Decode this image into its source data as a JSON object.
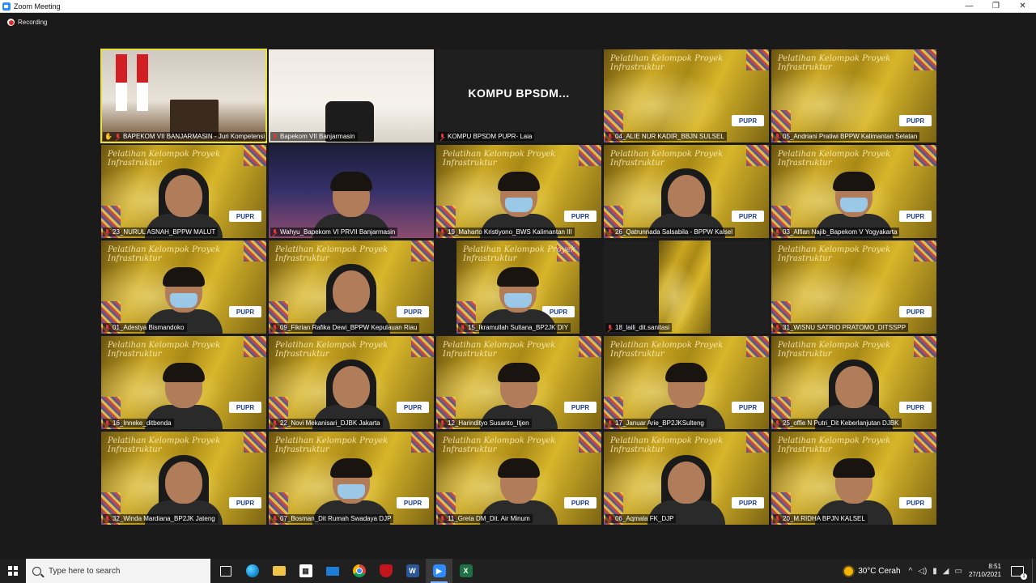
{
  "window": {
    "title": "Zoom Meeting",
    "controls": {
      "minimize": "—",
      "restore": "❐",
      "close": "✕"
    }
  },
  "recording": {
    "label": "Recording"
  },
  "tiles": [
    {
      "name": "BAPEKOM VII BANJARMASIN - Juri Kompetensi",
      "hand": "✋",
      "bg": "bg-stage",
      "active": true
    },
    {
      "name": "Bapekom VII Banjarmasin",
      "bg": "bg-office"
    },
    {
      "name": "KOMPU BPSDM PUPR- Laia",
      "bg": "bg-black",
      "big": "KOMPU  BPSDM..."
    },
    {
      "name": "04_ALIE NUR KADIR_BBJN SULSEL",
      "bg": "bg-gold",
      "slide": true
    },
    {
      "name": "05_Andriani Pratiwi BPPW Kalimantan Selatan",
      "bg": "bg-gold",
      "slide": true
    },
    {
      "name": "23_NURUL ASNAH_BPPW MALUT",
      "bg": "bg-gold",
      "slide": true,
      "person": "hijab"
    },
    {
      "name": "Wahyu_Bapekom VI PRVII Banjarmasin",
      "bg": "bg-city",
      "person": "man"
    },
    {
      "name": "19_Maharto Kristiyono_BWS Kalimantan III",
      "bg": "bg-gold",
      "slide": true,
      "person": "mask"
    },
    {
      "name": "26_Qatrunnada Salsabila - BPPW Kalsel",
      "bg": "bg-gold",
      "slide": true,
      "person": "hijab"
    },
    {
      "name": "03_Alfian Najib_Bapekom V Yogyakarta",
      "bg": "bg-gold",
      "slide": true,
      "person": "mask"
    },
    {
      "name": "01_Adestya Bismandoko",
      "bg": "bg-gold",
      "slide": true,
      "person": "mask"
    },
    {
      "name": "09_Fikrian Rafika Dewi_BPPW Kepulauan Riau",
      "bg": "bg-gold",
      "slide": true,
      "person": "hijab"
    },
    {
      "name": "15_Ikramullah Sultana_BP2JK DIY",
      "bg": "bg-gold",
      "slide": true,
      "person": "mask",
      "narrow": true
    },
    {
      "name": "18_laili_dit.sanitasi",
      "bg": "bg-black",
      "narrowTall": true
    },
    {
      "name": "31_WISNU SATRIO PRATOMO_DITSSPP",
      "bg": "bg-gold",
      "slide": true
    },
    {
      "name": "16_Inneke_ditbenda",
      "bg": "bg-gold",
      "slide": true,
      "person": "man"
    },
    {
      "name": "22_Novi Mekanisari_DJBK Jakarta",
      "bg": "bg-gold",
      "slide": true,
      "person": "hijab"
    },
    {
      "name": "12_Harindityo Susanto_Itjen",
      "bg": "bg-gold",
      "slide": true,
      "person": "man"
    },
    {
      "name": "17_Januar Arie_BP2JKSulteng",
      "bg": "bg-gold",
      "slide": true,
      "person": "man"
    },
    {
      "name": "25_offie N Putri_Dit Keberlanjutan DJBK",
      "bg": "bg-gold",
      "slide": true,
      "person": "hijab"
    },
    {
      "name": "32_Winda Mardiana_BP2JK Jateng",
      "bg": "bg-gold",
      "slide": true,
      "person": "hijab"
    },
    {
      "name": "07_Bosman_Dit Rumah Swadaya DJP",
      "bg": "bg-gold",
      "slide": true,
      "person": "mask"
    },
    {
      "name": "11_Greta DM_Dit. Air Minum",
      "bg": "bg-gold",
      "slide": true,
      "person": "man"
    },
    {
      "name": "06_Aqmala FK_DJP",
      "bg": "bg-gold",
      "slide": true,
      "person": "hijab"
    },
    {
      "name": "20_M.RIDHA BPJN KALSEL",
      "bg": "bg-gold",
      "slide": true,
      "person": "man"
    }
  ],
  "slide": {
    "script": "Pelatihan Kelompok Proyek Infrastruktur",
    "logo": "PUPR"
  },
  "taskbar": {
    "search_placeholder": "Type here to search",
    "weather": "30°C  Cerah",
    "time": "8:51",
    "date": "27/10/2021",
    "notifications": "1"
  }
}
